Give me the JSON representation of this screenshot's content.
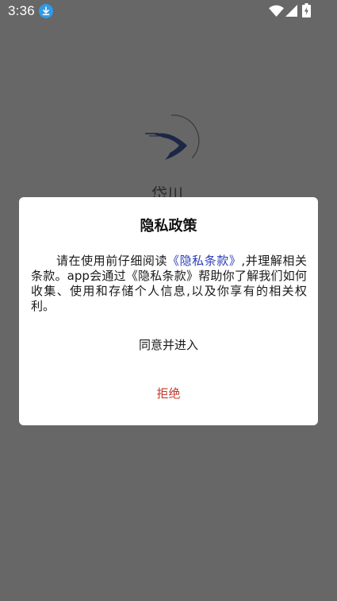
{
  "status_bar": {
    "time": "3:36",
    "icons": [
      "download-icon",
      "wifi-icon",
      "signal-icon",
      "battery-charging-icon"
    ]
  },
  "splash": {
    "logo": "app-logo",
    "app_name": "岱川"
  },
  "dialog": {
    "title": "隐私政策",
    "body_before": "请在使用前仔细阅读",
    "policy_link": "《隐私条款》",
    "body_after": ",并理解相关条款。app会通过《隐私条款》帮助你了解我们如何收集、使用和存储个人信息,以及你享有的相关权利。",
    "agree_label": "同意并进入",
    "reject_label": "拒绝"
  },
  "colors": {
    "overlay": "#676767",
    "link": "#2b3fb5",
    "reject": "#c0392b",
    "dialog_bg": "#ffffff"
  }
}
